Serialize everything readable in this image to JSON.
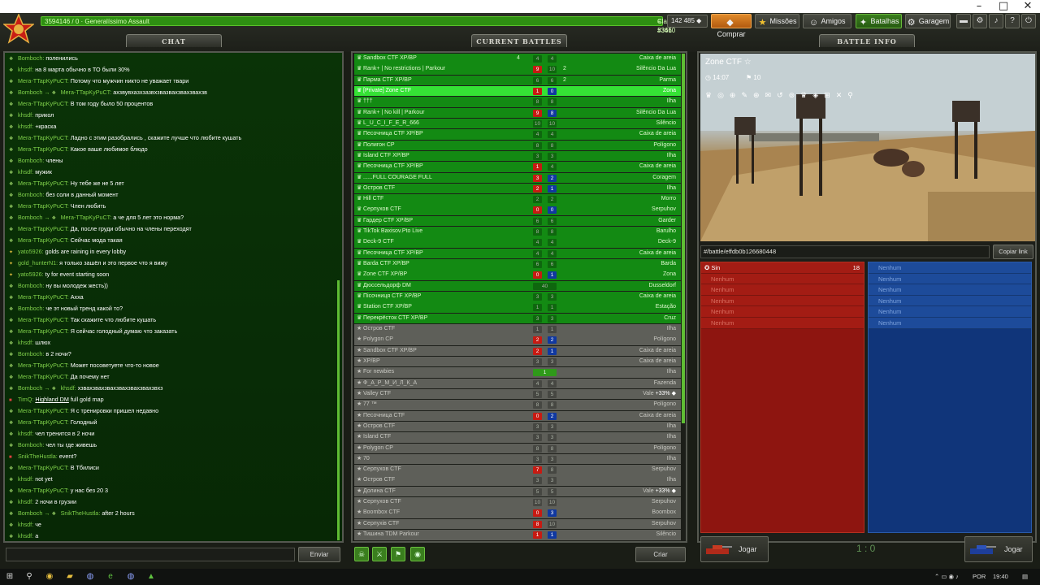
{
  "window": {
    "minimize": "–",
    "maximize": "□",
    "close": "✕"
  },
  "topbar": {
    "player": "3594146 / 0 · Generalíssimo Assault",
    "rank": "Classificação: #341 ",
    "rank_score": "≡ 33660",
    "crystals": "142 485 ◆",
    "buy": "Comprar",
    "missions": "Missões",
    "friends": "Amigos",
    "battles": "Batalhas",
    "garage": "Garagem"
  },
  "tabs": {
    "chat": "CHAT",
    "battles": "CURRENT BATTLES",
    "info": "BATTLE INFO"
  },
  "chat": [
    {
      "n": "Bomboch",
      "t": "поленились"
    },
    {
      "n": "khsdf",
      "t": "на 8 марта обычно в ТО были 30%"
    },
    {
      "n": "Mera-TTapKyPuCT",
      "t": "Потому что мужчин никто не уважает твари"
    },
    {
      "n": "Bomboch",
      "to": "Mera-TTapKyPuCT",
      "t": "ахзвувхазхзазвхзвазвахзвахзвахзв"
    },
    {
      "n": "Mera-TTapKyPuCT",
      "t": "В том году было 50 процентов"
    },
    {
      "n": "khsdf",
      "t": "прикол"
    },
    {
      "n": "khsdf",
      "t": "+краска"
    },
    {
      "n": "Mera-TTapKyPuCT",
      "t": "Ладно с этим разобрались , скажите лучше что любите кушать"
    },
    {
      "n": "Mera-TTapKyPuCT",
      "t": "Какое ваше любимое блюдо"
    },
    {
      "n": "Bomboch",
      "t": "члены"
    },
    {
      "n": "khsdf",
      "t": "мужик"
    },
    {
      "n": "Mera-TTapKyPuCT",
      "t": "Ну тебе же не 5 лет"
    },
    {
      "n": "Bomboch",
      "t": "без соли в данный момент"
    },
    {
      "n": "Mera-TTapKyPuCT",
      "t": "Член любить"
    },
    {
      "n": "Bomboch",
      "to": "Mera-TTapKyPuCT",
      "t": "а че для 5 лет это норма?"
    },
    {
      "n": "Mera-TTapKyPuCT",
      "t": "Да, после груди обычно на члены переходят"
    },
    {
      "n": "Mera-TTapKyPuCT",
      "t": "Сейчас мода такая"
    },
    {
      "n": "yato5926",
      "t": "golds are raining in every lobby",
      "rank": "yel"
    },
    {
      "n": "gold_hunterN1",
      "t": "я только зашёл и это первое что я вижу",
      "rank": "yel"
    },
    {
      "n": "yato5926",
      "t": "ty for event starting soon",
      "rank": "yel"
    },
    {
      "n": "Bomboch",
      "t": "ну вы молодеж жесть))"
    },
    {
      "n": "Mera-TTapKyPuCT",
      "t": "Ахха"
    },
    {
      "n": "Bomboch",
      "t": "че эт новый тренд какой то?"
    },
    {
      "n": "Mera-TTapKyPuCT",
      "t": "Так скажите что любите кушать"
    },
    {
      "n": "Mera-TTapKyPuCT",
      "t": "Я сейчас голодный думаю что заказать"
    },
    {
      "n": "khsdf",
      "t": "шлюх"
    },
    {
      "n": "Bomboch",
      "t": "в 2 ночи?"
    },
    {
      "n": "Mera-TTapKyPuCT",
      "t": "Может посоветуете что-то новое"
    },
    {
      "n": "Mera-TTapKyPuCT",
      "t": "Да почему нет"
    },
    {
      "n": "Bomboch",
      "to": "khsdf",
      "t": "хзвахзвахзвахзвахзвахзвахзвхз"
    },
    {
      "n": "TimQ",
      "t": "full gold map",
      "link": "Highland DM",
      "rank": "red"
    },
    {
      "n": "Mera-TTapKyPuCT",
      "t": "Я с тренировки пришел недавно"
    },
    {
      "n": "Mera-TTapKyPuCT",
      "t": "Голодный"
    },
    {
      "n": "khsdf",
      "t": "чел тренится в 2 ночи"
    },
    {
      "n": "Bomboch",
      "t": "чел ты где живешь"
    },
    {
      "n": "SnikTheHustla",
      "t": "event?",
      "rank": "red"
    },
    {
      "n": "Mera-TTapKyPuCT",
      "t": "В Тбилиси"
    },
    {
      "n": "khsdf",
      "t": "not yet"
    },
    {
      "n": "Mera-TTapKyPuCT",
      "t": "у нас без 20 3"
    },
    {
      "n": "khsdf",
      "t": "2 ночи в грузии"
    },
    {
      "n": "Bomboch",
      "to": "SnikTheHustla",
      "t": "after 2 hours"
    },
    {
      "n": "khsdf",
      "t": "че"
    },
    {
      "n": "khsdf",
      "t": "а"
    }
  ],
  "chat_send": "Enviar",
  "battles": [
    {
      "name": "Sandbox CTF XP/BP",
      "r": "4",
      "b": "4",
      "map": "Caixa de areia",
      "kind": "green",
      "players": "4"
    },
    {
      "name": "Rank+ | No restrictions | Parkour",
      "r": "9",
      "b": "10",
      "map": "Silêncio Da Lua",
      "kind": "green",
      "rr": true,
      "players2": "2"
    },
    {
      "name": "Парма CTF XP/BP",
      "r": "6",
      "b": "6",
      "map": "Parma",
      "kind": "green",
      "players2": "2"
    },
    {
      "name": "[Private] Zone CTF",
      "r": "1",
      "b": "0",
      "map": "Zona",
      "kind": "sel",
      "rr": true,
      "bb": true
    },
    {
      "name": "†††",
      "r": "8",
      "b": "8",
      "map": "Ilha",
      "kind": "green"
    },
    {
      "name": "Rank+ | No kill | Parkour",
      "r": "9",
      "b": "8",
      "map": "Silêncio Da Lua",
      "kind": "green",
      "rr": true,
      "bb": true
    },
    {
      "name": "L_U_C_I_F_E_R_666",
      "r": "10",
      "b": "10",
      "map": "Silêncio",
      "kind": "green"
    },
    {
      "name": "Песочница CTF XP/BP",
      "r": "4",
      "b": "4",
      "map": "Caixa de areia",
      "kind": "green"
    },
    {
      "name": "Полигон CP",
      "r": "8",
      "b": "8",
      "map": "Polígono",
      "kind": "green"
    },
    {
      "name": "Island CTF XP/BP",
      "r": "3",
      "b": "3",
      "map": "Ilha",
      "kind": "green"
    },
    {
      "name": "Песочница CTF XP/BP",
      "r": "1",
      "b": "4",
      "map": "Caixa de areia",
      "kind": "green",
      "rr": true
    },
    {
      "name": "......FULL COURAGE FULL",
      "r": "3",
      "b": "2",
      "map": "Coragem",
      "kind": "green",
      "rr": true,
      "bb": true
    },
    {
      "name": "Остров CTF",
      "r": "2",
      "b": "1",
      "map": "Ilha",
      "kind": "green",
      "rr": true,
      "bb": true
    },
    {
      "name": "Hill CTF",
      "r": "2",
      "b": "2",
      "map": "Morro",
      "kind": "green"
    },
    {
      "name": "Серпухов CTF",
      "r": "0",
      "b": "0",
      "map": "Serpuhov",
      "kind": "green",
      "rr": true,
      "bb": true
    },
    {
      "name": "Гардер CTF XP/BP",
      "r": "6",
      "b": "6",
      "map": "Garder",
      "kind": "green"
    },
    {
      "name": "TikTok Baxisov.Pto Live",
      "r": "8",
      "b": "8",
      "map": "Barulho",
      "kind": "green"
    },
    {
      "name": "Deck-9 CTF",
      "r": "4",
      "b": "4",
      "map": "Deck-9",
      "kind": "green"
    },
    {
      "name": "Песочница CTF XP/BP",
      "r": "4",
      "b": "4",
      "map": "Caixa de areia",
      "kind": "green"
    },
    {
      "name": "Barda CTF XP/BP",
      "r": "6",
      "b": "6",
      "map": "Barda",
      "kind": "green"
    },
    {
      "name": "Zone CTF XP/BP",
      "r": "0",
      "b": "1",
      "map": "Zona",
      "kind": "green",
      "rr": true,
      "bb": true
    },
    {
      "name": "Дюссельдорф DM",
      "single": "40",
      "map": "Dusseldorf",
      "kind": "green"
    },
    {
      "name": "Пісочниця CTF XP/BP",
      "r": "3",
      "b": "3",
      "map": "Caixa de areia",
      "kind": "green"
    },
    {
      "name": "Station CTF XP/BP",
      "r": "1",
      "b": "1",
      "map": "Estação",
      "kind": "green"
    },
    {
      "name": "Перекрёсток CTF XP/BP",
      "r": "3",
      "b": "3",
      "map": "Cruz",
      "kind": "green"
    },
    {
      "name": "Остров CTF",
      "r": "1",
      "b": "1",
      "map": "Ilha",
      "kind": "gray"
    },
    {
      "name": "Polygon CP",
      "r": "2",
      "b": "2",
      "map": "Polígono",
      "kind": "gray",
      "rr": true,
      "bb": true
    },
    {
      "name": "Sandbox CTF XP/BP",
      "r": "2",
      "b": "1",
      "map": "Caixa de areia",
      "kind": "gray",
      "rr": true,
      "bb": true
    },
    {
      "name": "XP/BP",
      "r": "3",
      "b": "3",
      "map": "Caixa de areia",
      "kind": "gray"
    },
    {
      "name": "For newbies",
      "single": "1",
      "lg": true,
      "map": "Ilha",
      "kind": "gray"
    },
    {
      "name": "Ф_А_Р_М_И_Л_К_А",
      "r": "4",
      "b": "4",
      "map": "Fazenda",
      "kind": "gray"
    },
    {
      "name": "Valley CTF",
      "r": "5",
      "b": "5",
      "map": "Vale",
      "bonus": "+33% ◆",
      "kind": "gray"
    },
    {
      "name": "77 ™",
      "r": "8",
      "b": "8",
      "map": "Polígono",
      "kind": "gray"
    },
    {
      "name": "Песочница CTF",
      "r": "0",
      "b": "2",
      "map": "Caixa de areia",
      "kind": "gray",
      "rr": true,
      "bb": true
    },
    {
      "name": "Остров CTF",
      "r": "3",
      "b": "3",
      "map": "Ilha",
      "kind": "gray"
    },
    {
      "name": "Island CTF",
      "r": "3",
      "b": "3",
      "map": "Ilha",
      "kind": "gray"
    },
    {
      "name": "Polygon CP",
      "r": "8",
      "b": "8",
      "map": "Polígono",
      "kind": "gray"
    },
    {
      "name": "70",
      "r": "3",
      "b": "3",
      "map": "Ilha",
      "kind": "gray"
    },
    {
      "name": "Серпухов CTF",
      "r": "7",
      "b": "8",
      "map": "Serpuhov",
      "kind": "gray",
      "rr": true
    },
    {
      "name": "Остров CTF",
      "r": "3",
      "b": "3",
      "map": "Ilha",
      "kind": "gray"
    },
    {
      "name": "Долина CTF",
      "r": "5",
      "b": "5",
      "map": "Vale",
      "bonus": "+33% ◆",
      "kind": "gray"
    },
    {
      "name": "Серпухов CTF",
      "r": "10",
      "b": "10",
      "map": "Serpuhov",
      "kind": "gray"
    },
    {
      "name": "Boombox CTF",
      "r": "0",
      "b": "3",
      "map": "Boombox",
      "kind": "gray",
      "rr": true,
      "bb": true
    },
    {
      "name": "Серпухів CTF",
      "r": "8",
      "b": "10",
      "map": "Serpuhov",
      "kind": "gray",
      "rr": true
    },
    {
      "name": "Тишина TDM Parkour",
      "r": "1",
      "b": "1",
      "map": "Silêncio",
      "kind": "gray",
      "rr": true,
      "bb": true
    }
  ],
  "create": "Criar",
  "info": {
    "map": "Zone CTF",
    "time": "14:07",
    "flags": "10",
    "link": "#/battle/effdb0b126680448",
    "copy": "Copiar link",
    "red": [
      {
        "n": "Sin",
        "s": "18",
        "me": true
      },
      {
        "n": "Nenhum"
      },
      {
        "n": "Nenhum"
      },
      {
        "n": "Nenhum"
      },
      {
        "n": "Nenhum"
      },
      {
        "n": "Nenhum"
      }
    ],
    "blue": [
      {
        "n": "Nenhum"
      },
      {
        "n": "Nenhum"
      },
      {
        "n": "Nenhum"
      },
      {
        "n": "Nenhum"
      },
      {
        "n": "Nenhum"
      },
      {
        "n": "Nenhum"
      }
    ],
    "play_red": "Jogar",
    "play_blue": "Jogar",
    "score": "1 : 0"
  },
  "taskbar": {
    "lang": "POR",
    "time": "19:40"
  }
}
